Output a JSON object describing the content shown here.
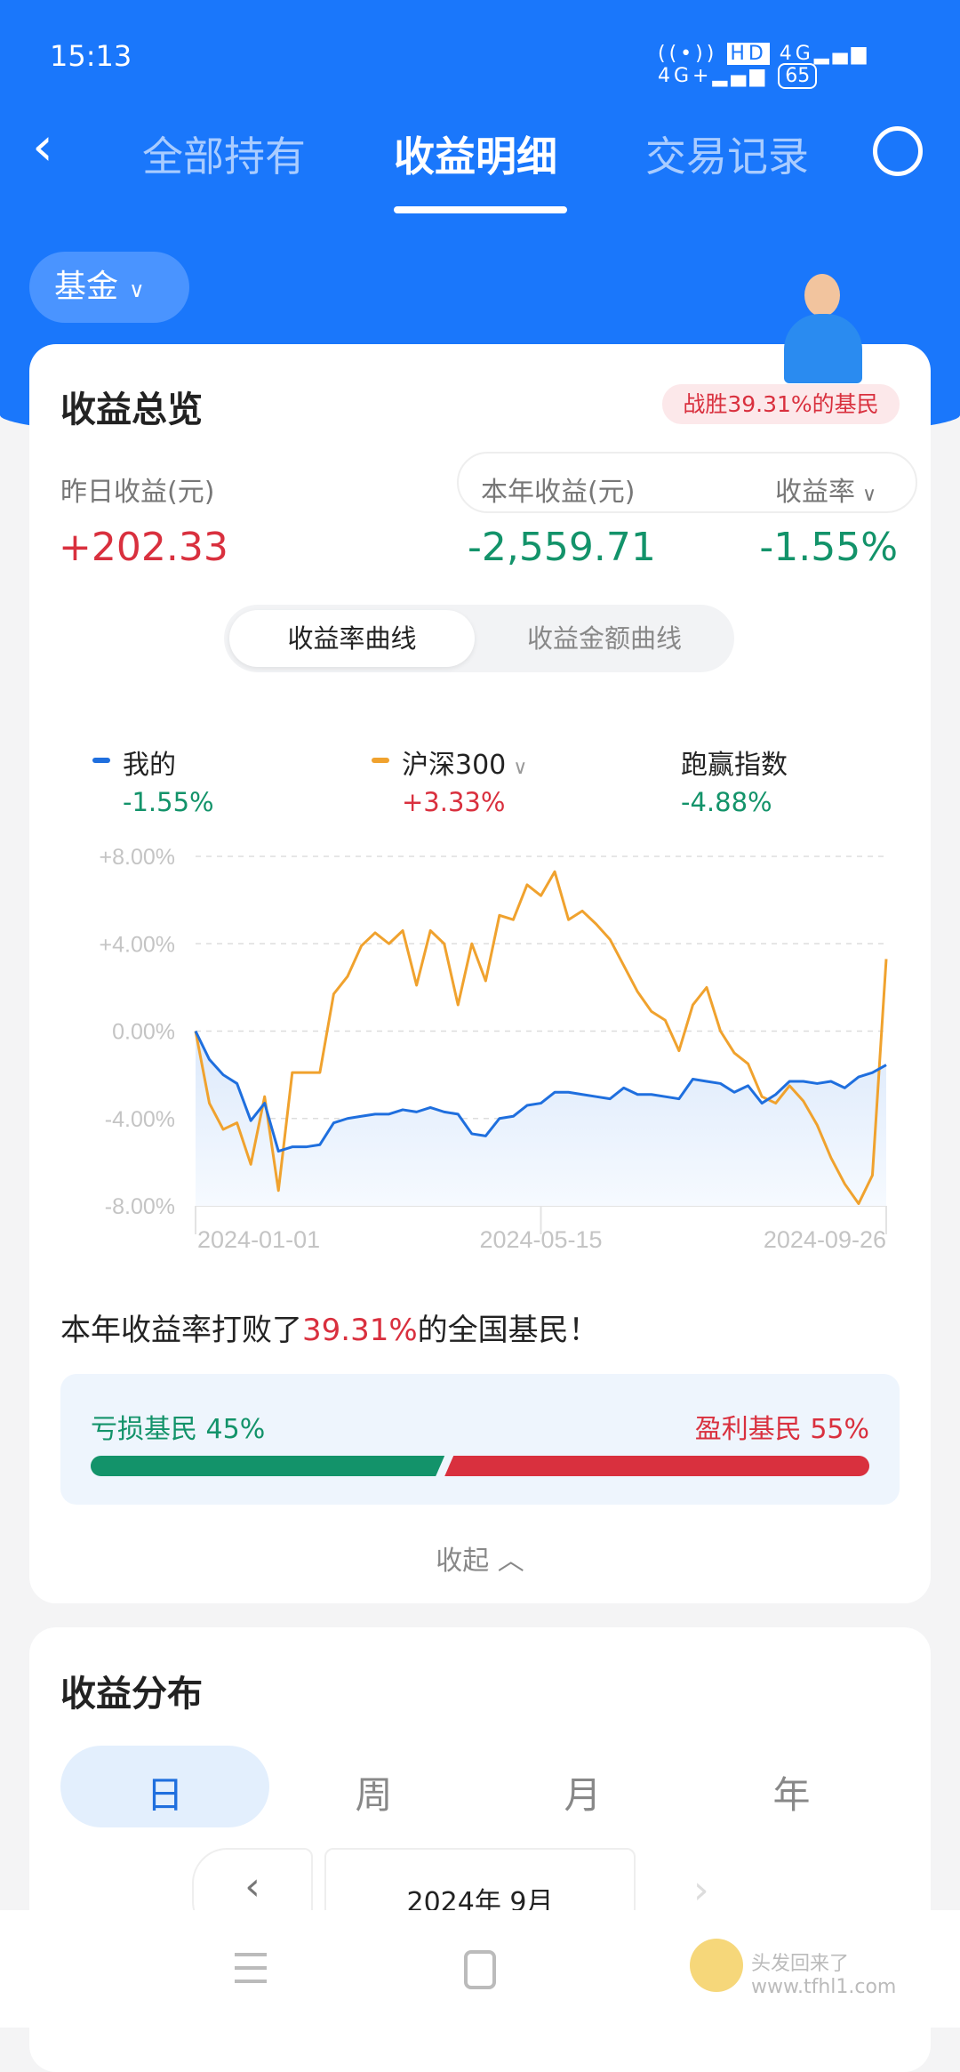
{
  "status": {
    "time": "15:13",
    "battery": "65",
    "network": [
      "HD",
      "4G",
      "4G+"
    ]
  },
  "nav": {
    "tabs": [
      "全部持有",
      "收益明细",
      "交易记录"
    ],
    "active": 1
  },
  "filter": {
    "label": "基金"
  },
  "overview": {
    "title": "收益总览",
    "badge": "战胜39.31%的基民",
    "yesterday_label": "昨日收益(元)",
    "yesterday_value": "+202.33",
    "year_label": "本年收益(元)",
    "year_value": "-2,559.71",
    "rate_label": "收益率",
    "rate_value": "-1.55%",
    "segments": [
      "收益率曲线",
      "收益金额曲线"
    ],
    "legend": [
      {
        "name": "我的",
        "value": "-1.55%",
        "color": "#1f6fde"
      },
      {
        "name": "沪深300",
        "value": "+3.33%",
        "color": "#f0a22e"
      },
      {
        "name": "跑赢指数",
        "value": "-4.88%"
      }
    ],
    "beat_prefix": "本年收益率打败了",
    "beat_pct": "39.31%",
    "beat_suffix": "的全国基民！",
    "loss_label": "亏损基民 45%",
    "profit_label": "盈利基民 55%",
    "loss_share": 45,
    "profit_share": 55,
    "collapse": "收起"
  },
  "chart_data": {
    "type": "line",
    "ylim": [
      -8,
      8
    ],
    "yticks": [
      "+8.00%",
      "+4.00%",
      "0.00%",
      "-4.00%",
      "-8.00%"
    ],
    "ytick_values": [
      8,
      4,
      0,
      -4,
      -8
    ],
    "x_labels": [
      "2024-01-01",
      "2024-05-15",
      "2024-09-26"
    ],
    "grid": true,
    "series": [
      {
        "name": "我的",
        "color": "#1f6fde",
        "values": [
          0,
          -1.3,
          -2.0,
          -2.4,
          -4.1,
          -3.3,
          -5.5,
          -5.3,
          -5.3,
          -5.2,
          -4.2,
          -4.0,
          -3.9,
          -3.8,
          -3.8,
          -3.6,
          -3.7,
          -3.5,
          -3.7,
          -3.8,
          -4.7,
          -4.8,
          -4.0,
          -3.9,
          -3.4,
          -3.3,
          -2.8,
          -2.8,
          -2.9,
          -3.0,
          -3.1,
          -2.6,
          -2.9,
          -2.9,
          -3.0,
          -3.1,
          -2.2,
          -2.3,
          -2.4,
          -2.8,
          -2.5,
          -3.3,
          -2.9,
          -2.3,
          -2.3,
          -2.4,
          -2.3,
          -2.6,
          -2.1,
          -1.9,
          -1.55
        ]
      },
      {
        "name": "沪深300",
        "color": "#f0a22e",
        "values": [
          0,
          -3.3,
          -4.5,
          -4.2,
          -6.1,
          -3.0,
          -7.3,
          -1.9,
          -1.9,
          -1.9,
          1.7,
          2.5,
          3.9,
          4.5,
          4.0,
          4.6,
          2.1,
          4.6,
          4.0,
          1.2,
          4.0,
          2.3,
          5.3,
          5.1,
          6.7,
          6.2,
          7.3,
          5.1,
          5.5,
          4.9,
          4.2,
          3.0,
          1.8,
          0.9,
          0.5,
          -0.9,
          1.2,
          2.0,
          0.0,
          -1.0,
          -1.5,
          -3.0,
          -3.3,
          -2.5,
          -3.2,
          -4.3,
          -5.8,
          -7.0,
          -7.9,
          -6.6,
          3.3
        ]
      }
    ]
  },
  "distribution": {
    "title": "收益分布",
    "periods": [
      "日",
      "周",
      "月",
      "年"
    ],
    "active": 0,
    "month": "2024年 9月"
  },
  "watermark": "头发回来了 www.tfhl1.com"
}
